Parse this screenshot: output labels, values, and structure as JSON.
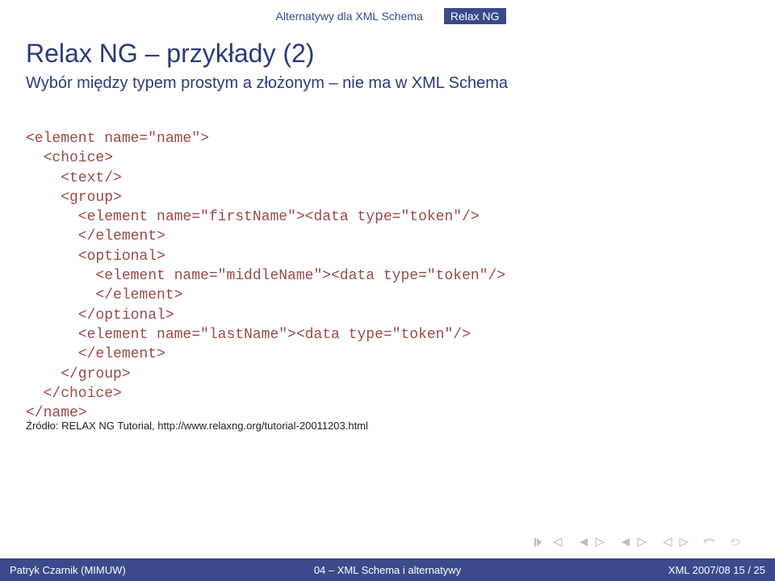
{
  "breadcrumb": {
    "item1": "Alternatywy dla XML Schema",
    "item2": "Relax NG"
  },
  "title": "Relax NG – przykłady (2)",
  "subtitle": "Wybór między typem prostym a złożonym – nie ma w XML Schema",
  "code": {
    "l1": "<element name=\"name\">",
    "l2": "  <choice>",
    "l3": "    <text/>",
    "l4": "    <group>",
    "l5": "      <element name=\"firstName\"><data type=\"token\"/>",
    "l6": "      </element>",
    "l7": "      <optional>",
    "l8": "        <element name=\"middleName\"><data type=\"token\"/>",
    "l9": "        </element>",
    "l10": "      </optional>",
    "l11": "      <element name=\"lastName\"><data type=\"token\"/>",
    "l12": "      </element>",
    "l13": "    </group>",
    "l14": "  </choice>",
    "l15": "</name>"
  },
  "source": "Źródło: RELAX NG Tutorial, http://www.relaxng.org/tutorial-20011203.html",
  "footer": {
    "left": "Patryk Czarnik (MIMUW)",
    "center": "04 – XML Schema i alternatywy",
    "right": "XML 2007/08      15 / 25"
  }
}
